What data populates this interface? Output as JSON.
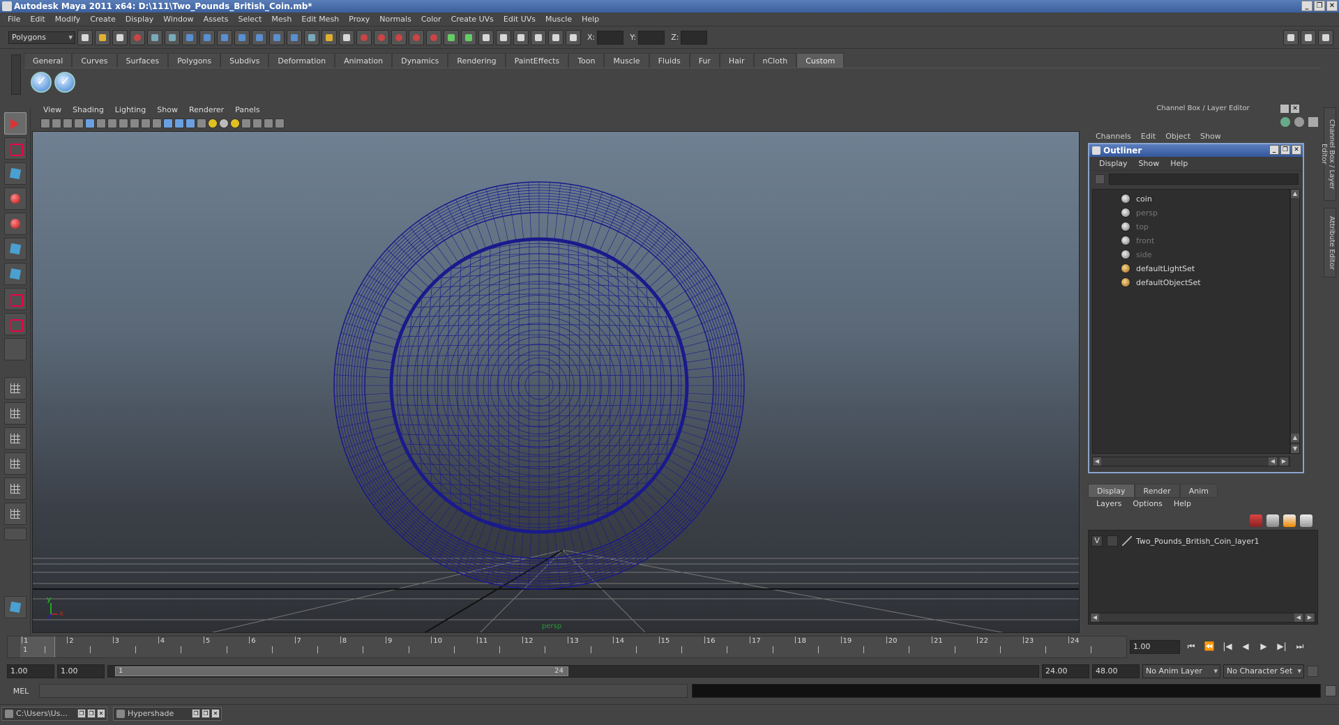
{
  "window": {
    "title": "Autodesk Maya 2011 x64: D:\\111\\Two_Pounds_British_Coin.mb*",
    "min": "_",
    "restore": "❐",
    "close": "✕"
  },
  "menubar": [
    "File",
    "Edit",
    "Modify",
    "Create",
    "Display",
    "Window",
    "Assets",
    "Select",
    "Mesh",
    "Edit Mesh",
    "Proxy",
    "Normals",
    "Color",
    "Create UVs",
    "Edit UVs",
    "Muscle",
    "Help"
  ],
  "statusline": {
    "mode_menu": "Polygons",
    "x_label": "X:",
    "y_label": "Y:",
    "z_label": "Z:"
  },
  "shelf": {
    "tabs": [
      "General",
      "Curves",
      "Surfaces",
      "Polygons",
      "Subdivs",
      "Deformation",
      "Animation",
      "Dynamics",
      "Rendering",
      "PaintEffects",
      "Toon",
      "Muscle",
      "Fluids",
      "Fur",
      "Hair",
      "nCloth",
      "Custom"
    ],
    "active_tab": "Custom"
  },
  "viewport": {
    "menu": [
      "View",
      "Shading",
      "Lighting",
      "Show",
      "Renderer",
      "Panels"
    ],
    "camera_label": "persp",
    "axis_y": "y",
    "axis_z": "z",
    "axis_x": "x"
  },
  "channel_box": {
    "header": "Channel Box / Layer Editor",
    "menu": [
      "Channels",
      "Edit",
      "Object",
      "Show"
    ]
  },
  "outliner": {
    "title": "Outliner",
    "menu": [
      "Display",
      "Show",
      "Help"
    ],
    "items": [
      {
        "label": "coin",
        "dim": false
      },
      {
        "label": "persp",
        "dim": true
      },
      {
        "label": "top",
        "dim": true
      },
      {
        "label": "front",
        "dim": true
      },
      {
        "label": "side",
        "dim": true
      },
      {
        "label": "defaultLightSet",
        "dim": false
      },
      {
        "label": "defaultObjectSet",
        "dim": false
      }
    ]
  },
  "layer_editor": {
    "tabs": [
      "Display",
      "Render",
      "Anim"
    ],
    "active_tab": "Display",
    "menu": [
      "Layers",
      "Options",
      "Help"
    ],
    "layer": {
      "visible": "V",
      "name": "Two_Pounds_British_Coin_layer1"
    }
  },
  "side_tabs": [
    "Channel Box / Layer Editor",
    "Attribute Editor"
  ],
  "timeline": {
    "frames": [
      "1",
      "2",
      "3",
      "4",
      "5",
      "6",
      "7",
      "8",
      "9",
      "10",
      "11",
      "12",
      "13",
      "14",
      "15",
      "16",
      "17",
      "18",
      "19",
      "20",
      "21",
      "22",
      "23",
      "24"
    ],
    "current_frame_marker": "1",
    "current_frame": "1.00"
  },
  "playback": [
    "⏮",
    "⏪",
    "|◀",
    "◀",
    "▶",
    "▶|",
    "⏭"
  ],
  "range": {
    "start": "1.00",
    "start_inner": "1.00",
    "slider_start": "1",
    "slider_end": "24",
    "end_inner": "24.00",
    "end": "48.00",
    "anim_layer": "No Anim Layer",
    "char_set": "No Character Set"
  },
  "command_line": {
    "label": "MEL"
  },
  "taskbar": [
    {
      "label": "C:\\Users\\Us..."
    },
    {
      "label": "Hypershade"
    }
  ],
  "colors": {
    "wireframe": "#1a1a8c",
    "viewport_top": "#6f8092",
    "accent_title": "#3b5f9c"
  }
}
